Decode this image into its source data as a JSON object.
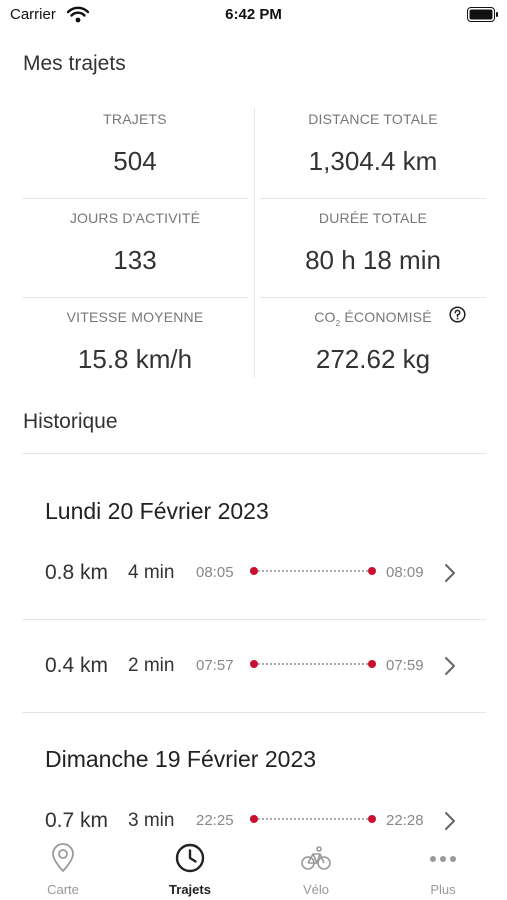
{
  "status_bar": {
    "carrier": "Carrier",
    "time": "6:42 PM"
  },
  "summary": {
    "title": "Mes trajets",
    "stats": [
      {
        "label": "TRAJETS",
        "value": "504"
      },
      {
        "label": "DISTANCE TOTALE",
        "value": "1,304.4 km"
      },
      {
        "label": "JOURS D'ACTIVITÉ",
        "value": "133"
      },
      {
        "label": "DURÉE TOTALE",
        "value": "80 h 18 min"
      },
      {
        "label": "VITESSE MOYENNE",
        "value": "15.8 km/h"
      },
      {
        "label_prefix": "CO",
        "label_sub": "2",
        "label_suffix": " ÉCONOMISÉ",
        "value": "272.62 kg"
      }
    ]
  },
  "history": {
    "title": "Historique",
    "days": [
      {
        "date": "Lundi 20 Février 2023",
        "trips": [
          {
            "distance": "0.8 km",
            "duration": "4 min",
            "start": "08:05",
            "end": "08:09"
          },
          {
            "distance": "0.4 km",
            "duration": "2 min",
            "start": "07:57",
            "end": "07:59"
          }
        ]
      },
      {
        "date": "Dimanche 19 Février 2023",
        "trips": [
          {
            "distance": "0.7 km",
            "duration": "3 min",
            "start": "22:25",
            "end": "22:28"
          }
        ]
      }
    ]
  },
  "tab_bar": {
    "tabs": [
      {
        "label": "Carte",
        "icon": "map-pin-icon",
        "active": false
      },
      {
        "label": "Trajets",
        "icon": "clock-icon",
        "active": true
      },
      {
        "label": "Vélo",
        "icon": "bicycle-icon",
        "active": false
      },
      {
        "label": "Plus",
        "icon": "more-icon",
        "active": false
      }
    ]
  },
  "colors": {
    "accent": "#c8102e",
    "text": "#222222",
    "muted": "#888888",
    "divider": "#e5e5e5"
  }
}
